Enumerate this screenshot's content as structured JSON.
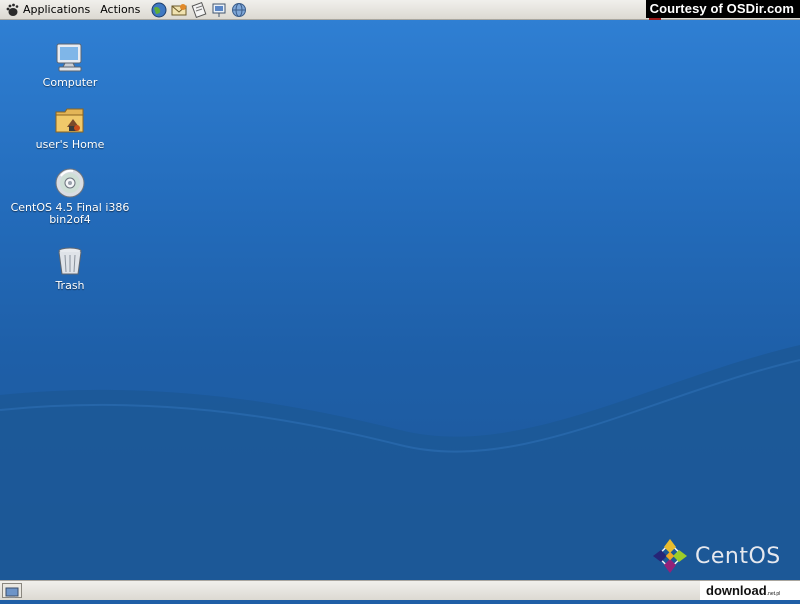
{
  "top_panel": {
    "menus": [
      "Applications",
      "Actions"
    ],
    "launchers": [
      "web-browser-icon",
      "email-icon",
      "office-writer-icon",
      "presentation-icon",
      "network-icon"
    ],
    "courtesy": "Courtesy of OSDir.com"
  },
  "desktop": {
    "icons": [
      {
        "label": "Computer",
        "icon": "computer-icon"
      },
      {
        "label": "user's Home",
        "icon": "home-folder-icon"
      },
      {
        "label": "CentOS 4.5 Final i386 bin2of4",
        "icon": "cdrom-icon"
      },
      {
        "label": "Trash",
        "icon": "trash-icon"
      }
    ],
    "brand": "CentOS"
  },
  "bottom_panel": {
    "watermark_main": "download",
    "watermark_suffix": ".net.pl"
  },
  "colors": {
    "desktop_top": "#2f7fd3",
    "desktop_bottom": "#1d5798",
    "panel": "#e6e4de"
  }
}
